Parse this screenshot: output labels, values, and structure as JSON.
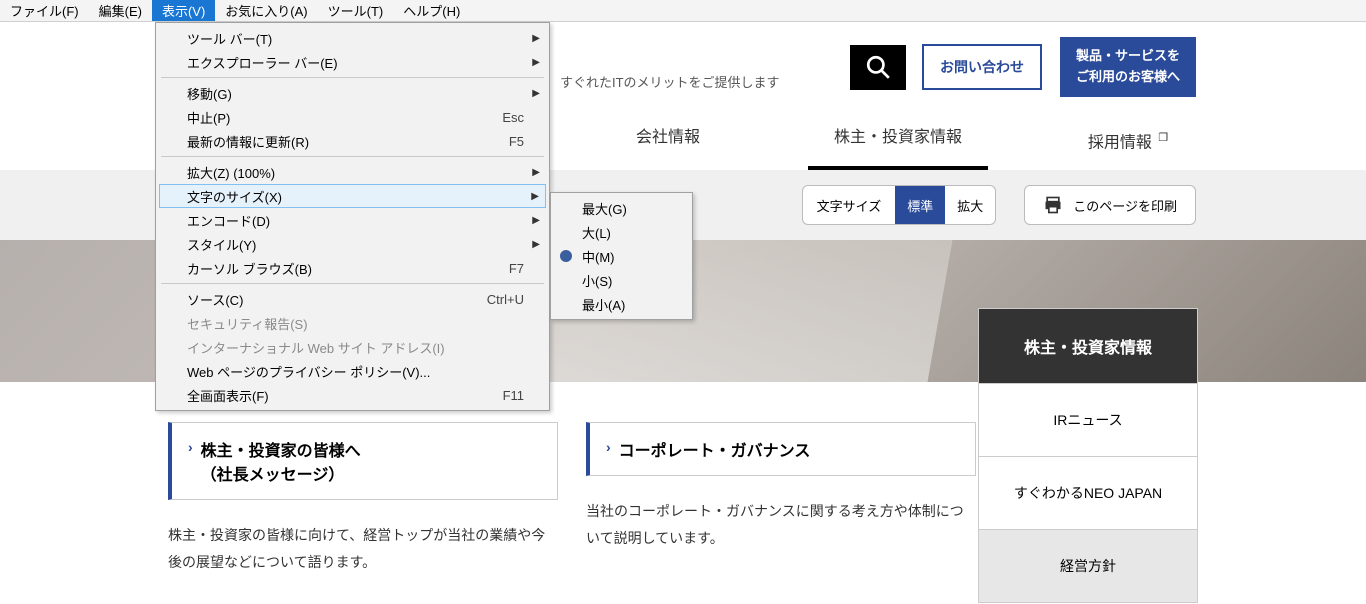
{
  "menubar": {
    "items": [
      {
        "label": "ファイル(F)"
      },
      {
        "label": "編集(E)"
      },
      {
        "label": "表示(V)",
        "active": true
      },
      {
        "label": "お気に入り(A)"
      },
      {
        "label": "ツール(T)"
      },
      {
        "label": "ヘルプ(H)"
      }
    ]
  },
  "menu_view": [
    {
      "type": "item",
      "label": "ツール バー(T)",
      "arrow": true
    },
    {
      "type": "item",
      "label": "エクスプローラー バー(E)",
      "arrow": true
    },
    {
      "type": "sep"
    },
    {
      "type": "item",
      "label": "移動(G)",
      "arrow": true
    },
    {
      "type": "item",
      "label": "中止(P)",
      "shortcut": "Esc"
    },
    {
      "type": "item",
      "label": "最新の情報に更新(R)",
      "shortcut": "F5"
    },
    {
      "type": "sep"
    },
    {
      "type": "item",
      "label": "拡大(Z) (100%)",
      "arrow": true
    },
    {
      "type": "item",
      "label": "文字のサイズ(X)",
      "arrow": true,
      "hover": true
    },
    {
      "type": "item",
      "label": "エンコード(D)",
      "arrow": true
    },
    {
      "type": "item",
      "label": "スタイル(Y)",
      "arrow": true
    },
    {
      "type": "item",
      "label": "カーソル ブラウズ(B)",
      "shortcut": "F7"
    },
    {
      "type": "sep"
    },
    {
      "type": "item",
      "label": "ソース(C)",
      "shortcut": "Ctrl+U"
    },
    {
      "type": "item",
      "label": "セキュリティ報告(S)",
      "disabled": true
    },
    {
      "type": "item",
      "label": "インターナショナル Web サイト アドレス(I)",
      "disabled": true
    },
    {
      "type": "item",
      "label": "Web ページのプライバシー ポリシー(V)..."
    },
    {
      "type": "item",
      "label": "全画面表示(F)",
      "shortcut": "F11"
    }
  ],
  "menu_textsize": [
    {
      "label": "最大(G)"
    },
    {
      "label": "大(L)"
    },
    {
      "label": "中(M)",
      "selected": true
    },
    {
      "label": "小(S)"
    },
    {
      "label": "最小(A)"
    }
  ],
  "page": {
    "tagline": "すぐれたITのメリットをご提供します",
    "contact_label": "お問い合わせ",
    "cta_line1": "製品・サービスを",
    "cta_line2": "ご利用のお客様へ",
    "nav": [
      {
        "label": "会社情報"
      },
      {
        "label": "株主・投資家情報",
        "active": true
      },
      {
        "label": "採用情報",
        "ext": true
      }
    ],
    "fontsize_label": "文字サイズ",
    "fontsize_std": "標準",
    "fontsize_lg": "拡大",
    "print_label": "このページを印刷",
    "sidebar": {
      "header": "株主・投資家情報",
      "items": [
        "IRニュース",
        "すぐわかるNEO JAPAN",
        "経営方針"
      ]
    },
    "blocks": [
      {
        "title_l1": "株主・投資家の皆様へ",
        "title_l2": "（社長メッセージ）",
        "body": "株主・投資家の皆様に向けて、経営トップが当社の業績や今後の展望などについて語ります。"
      },
      {
        "title_l1": "コーポレート・ガバナンス",
        "title_l2": "",
        "body": "当社のコーポレート・ガバナンスに関する考え方や体制について説明しています。"
      }
    ]
  }
}
